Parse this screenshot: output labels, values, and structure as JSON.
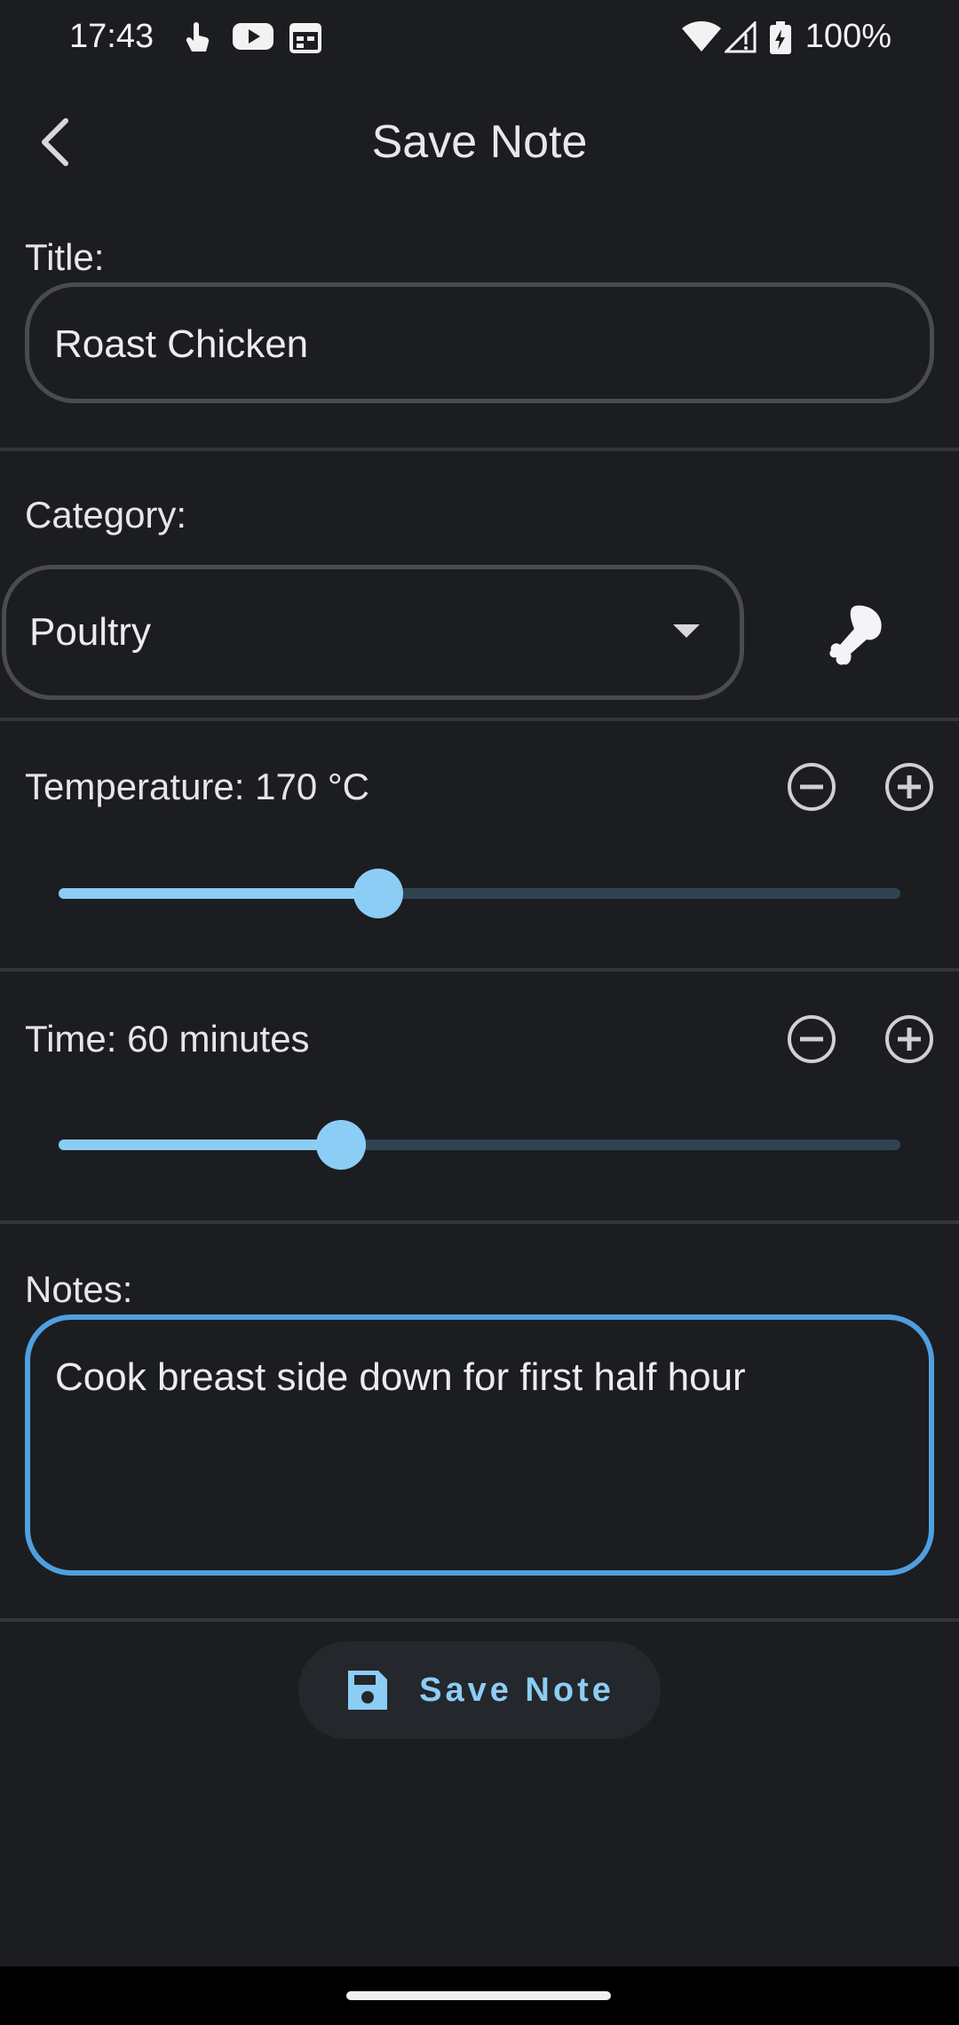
{
  "status_bar": {
    "time": "17:43",
    "battery": "100%",
    "icons": [
      "touch-icon",
      "youtube-icon",
      "calendar-icon",
      "wifi-icon",
      "signal-icon",
      "battery-icon"
    ]
  },
  "app_bar": {
    "title": "Save Note",
    "back_icon": "back-arrow-icon"
  },
  "title_section": {
    "label": "Title:",
    "value": "Roast Chicken"
  },
  "category_section": {
    "label": "Category:",
    "value": "Poultry",
    "icon": "drumstick-icon"
  },
  "temperature_section": {
    "label": "Temperature: 170 °C",
    "value": 170,
    "slider_fraction": 0.38
  },
  "time_section": {
    "label": "Time: 60 minutes",
    "value": 60,
    "slider_fraction": 0.335
  },
  "notes_section": {
    "label": "Notes:",
    "value": "Cook breast side down for first half hour"
  },
  "save_button": {
    "label": "Save Note",
    "icon": "save-icon"
  },
  "colors": {
    "background": "#1c1d21",
    "accent": "#8ccdf6",
    "focus_border": "#4f9fe0"
  }
}
